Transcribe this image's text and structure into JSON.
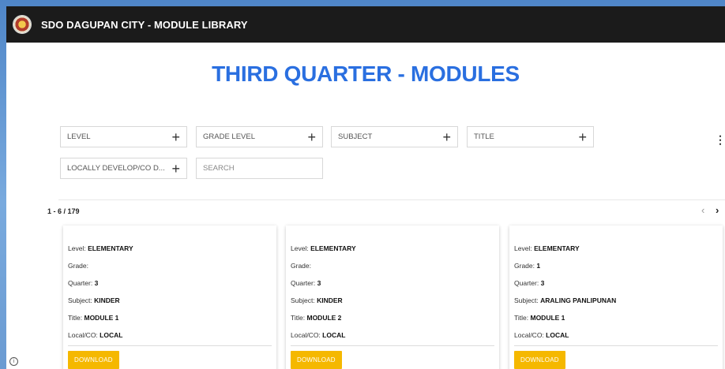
{
  "app": {
    "title": "SDO DAGUPAN CITY - MODULE LIBRARY"
  },
  "page": {
    "title": "THIRD QUARTER - MODULES"
  },
  "filters": [
    {
      "label": "LEVEL"
    },
    {
      "label": "GRADE LEVEL"
    },
    {
      "label": "SUBJECT"
    },
    {
      "label": "TITLE"
    },
    {
      "label": "LOCALLY DEVELOP/CO D..."
    }
  ],
  "search": {
    "placeholder": "SEARCH"
  },
  "results": {
    "range": "1 - 6 / 179"
  },
  "pager": {
    "prev": "‹",
    "next": "›"
  },
  "card_labels": {
    "level": "Level:",
    "grade": "Grade:",
    "quarter": "Quarter:",
    "subject": "Subject:",
    "title": "Title:",
    "local": "Local/CO:",
    "download": "DOWNLOAD"
  },
  "cards": [
    {
      "level": "ELEMENTARY",
      "grade": "",
      "quarter": "3",
      "subject": "KINDER",
      "title": "MODULE 1",
      "local": "LOCAL"
    },
    {
      "level": "ELEMENTARY",
      "grade": "",
      "quarter": "3",
      "subject": "KINDER",
      "title": "MODULE 2",
      "local": "LOCAL"
    },
    {
      "level": "ELEMENTARY",
      "grade": "1",
      "quarter": "3",
      "subject": "ARALING PANLIPUNAN",
      "title": "MODULE 1",
      "local": "LOCAL"
    }
  ],
  "icons": {
    "more": "more-vertical-icon",
    "info": "info-icon",
    "plus": "plus-icon",
    "logo": "sdo-logo"
  },
  "colors": {
    "accent": "#2a6fe0",
    "download": "#f5b800",
    "topbar": "#1b1b1b"
  }
}
